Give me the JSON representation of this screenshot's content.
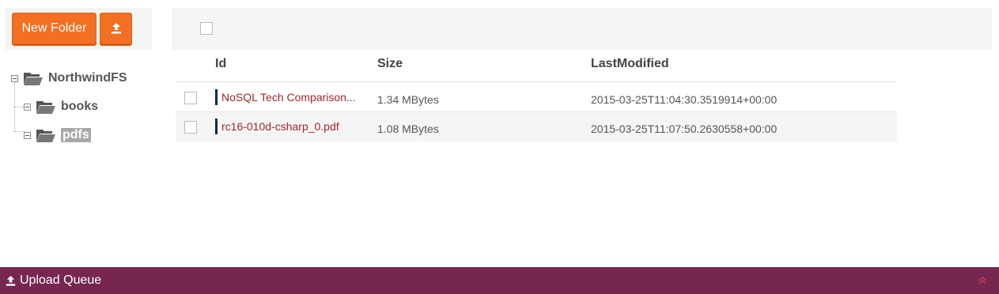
{
  "toolbar": {
    "new_folder_label": "New Folder",
    "upload_icon": "upload-icon",
    "accent_color": "#f36f21"
  },
  "tree": {
    "root": {
      "label": "NorthwindFS",
      "icon": "folder-open-icon"
    },
    "children": [
      {
        "label": "books",
        "icon": "folder-open-icon"
      },
      {
        "label": "pdfs",
        "icon": "folder-open-icon",
        "selected": true
      }
    ]
  },
  "grid": {
    "columns": [
      "Id",
      "Size",
      "LastModified"
    ],
    "rows": [
      {
        "id": "NoSQL Tech Comparison...",
        "size": "1.34 MBytes",
        "last_modified": "2015-03-25T11:04:30.3519914+00:00"
      },
      {
        "id": "rc16-010d-csharp_0.pdf",
        "size": "1.08 MBytes",
        "last_modified": "2015-03-25T11:07:50.2630558+00:00"
      }
    ],
    "id_link_color": "#a3272d"
  },
  "upload_queue": {
    "label": "Upload Queue",
    "icon": "upload-icon",
    "bar_color": "#76264f"
  }
}
